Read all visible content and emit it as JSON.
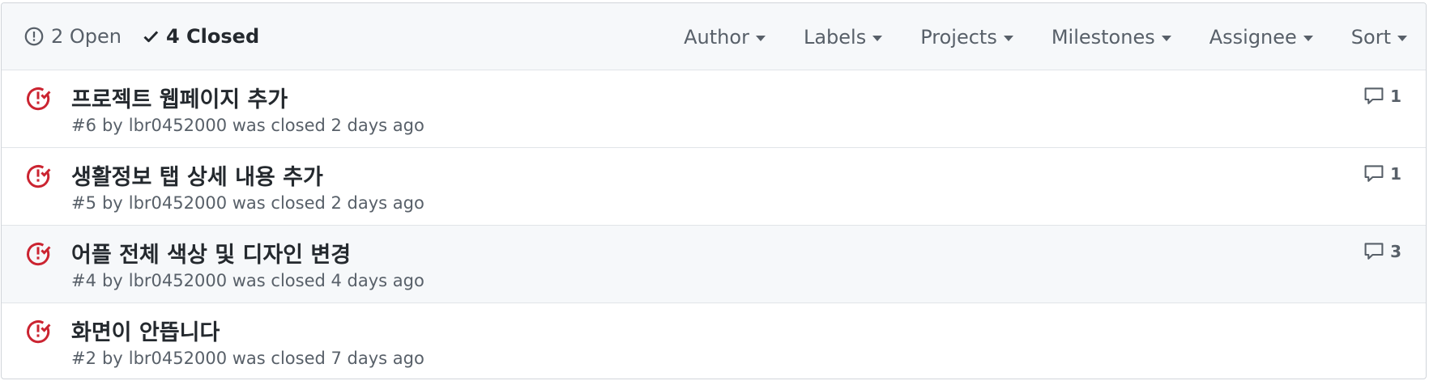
{
  "colors": {
    "closed_red": "#cb2431",
    "muted": "#586069",
    "text": "#24292e"
  },
  "states": {
    "open": {
      "icon": "issue-opened-icon",
      "label": "2 Open"
    },
    "closed": {
      "icon": "check-icon",
      "label": "4 Closed"
    }
  },
  "filters": [
    {
      "label": "Author"
    },
    {
      "label": "Labels"
    },
    {
      "label": "Projects"
    },
    {
      "label": "Milestones"
    },
    {
      "label": "Assignee"
    },
    {
      "label": "Sort"
    }
  ],
  "issues": [
    {
      "title": "프로젝트 웹페이지 추가",
      "number": "#6",
      "by": "by",
      "author": "lbr0452000",
      "closed_text": "was closed 2 days ago",
      "comments": "1",
      "icon": "issue-closed-icon"
    },
    {
      "title": "생활정보 탭 상세 내용 추가",
      "number": "#5",
      "by": "by",
      "author": "lbr0452000",
      "closed_text": "was closed 2 days ago",
      "comments": "1",
      "icon": "issue-closed-icon"
    },
    {
      "title": "어플 전체 색상 및 디자인 변경",
      "number": "#4",
      "by": "by",
      "author": "lbr0452000",
      "closed_text": "was closed 4 days ago",
      "comments": "3",
      "icon": "issue-closed-icon"
    },
    {
      "title": "화면이 안뜹니다",
      "number": "#2",
      "by": "by",
      "author": "lbr0452000",
      "closed_text": "was closed 7 days ago",
      "comments": "",
      "icon": "issue-closed-icon"
    }
  ]
}
